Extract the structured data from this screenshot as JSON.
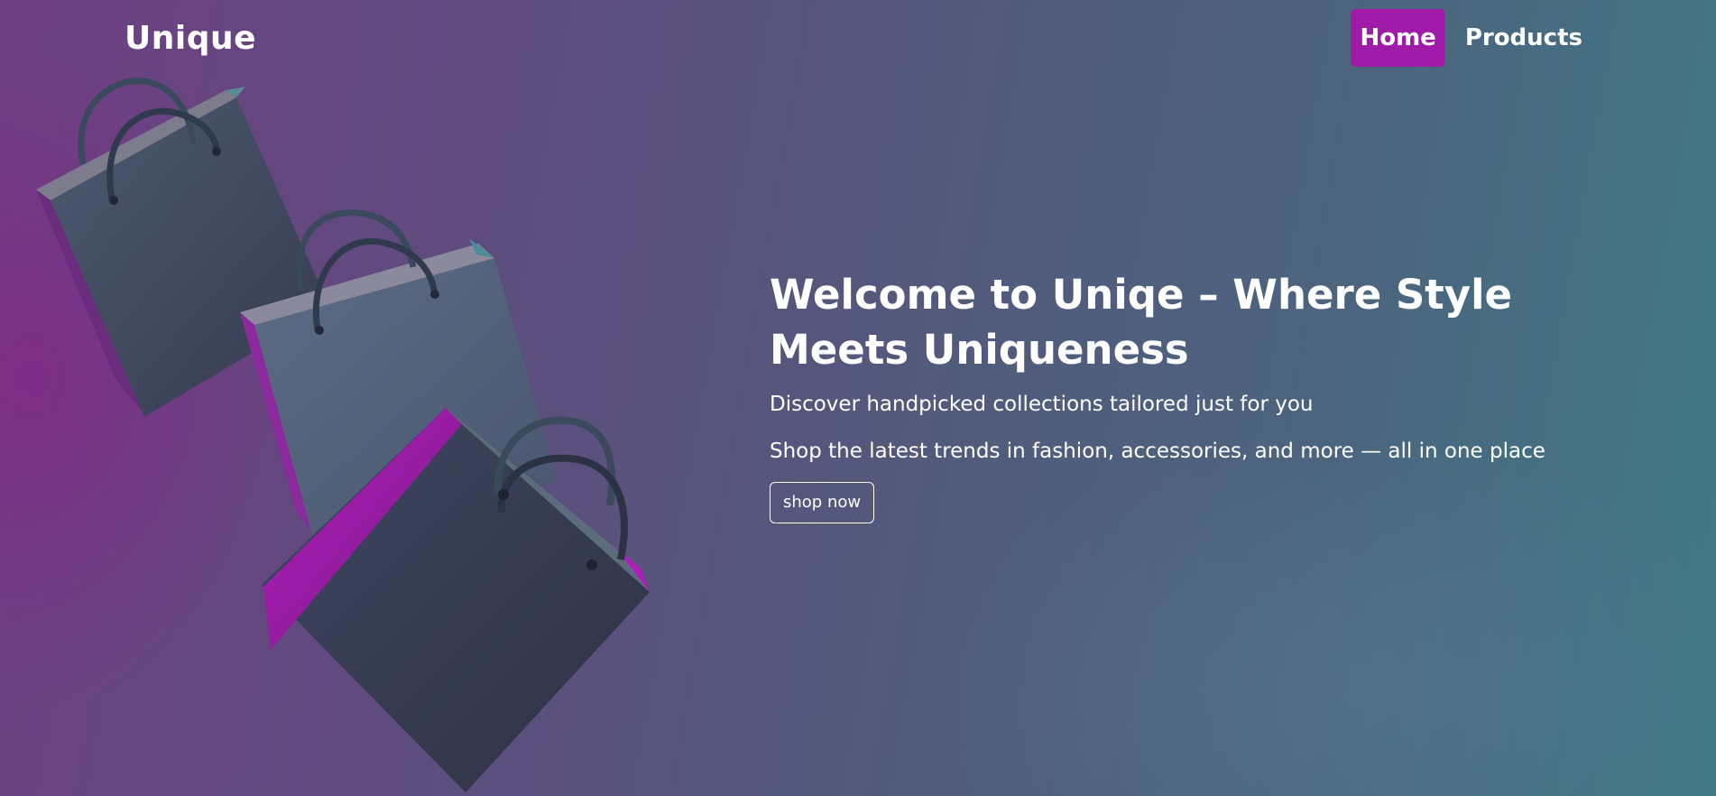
{
  "navbar": {
    "brand": "Unique",
    "links": [
      {
        "label": "Home",
        "active": true
      },
      {
        "label": "Products",
        "active": false
      }
    ]
  },
  "hero": {
    "headline": "Welcome to Uniqe – Where Style Meets Uniqueness",
    "subheadline": "Discover handpicked collections tailored just for you",
    "tagline": "Shop the latest trends in fashion, accessories, and more — all in one place",
    "cta_label": "shop now",
    "image": "shopping-bags-illustration"
  },
  "colors": {
    "accent": "#a01ca8",
    "text": "#ffffff",
    "background_left": "#6e3f82",
    "background_right": "#3f7a86"
  }
}
